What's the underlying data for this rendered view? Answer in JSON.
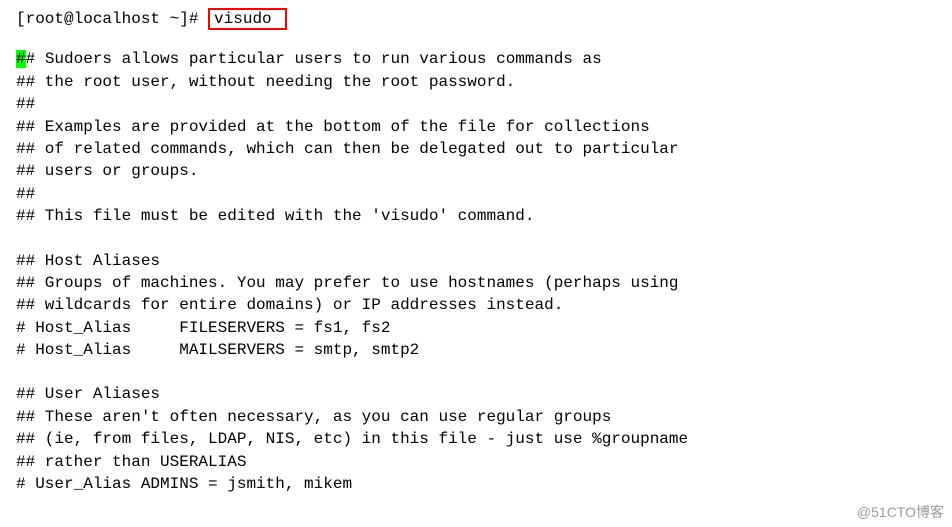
{
  "prompt": {
    "prefix": "[root@localhost ~]#",
    "command": "visudo"
  },
  "cursor_char": "#",
  "lines": [
    "# Sudoers allows particular users to run various commands as",
    "## the root user, without needing the root password.",
    "##",
    "## Examples are provided at the bottom of the file for collections",
    "## of related commands, which can then be delegated out to particular",
    "## users or groups.",
    "##",
    "## This file must be edited with the 'visudo' command.",
    "",
    "## Host Aliases",
    "## Groups of machines. You may prefer to use hostnames (perhaps using",
    "## wildcards for entire domains) or IP addresses instead.",
    "# Host_Alias     FILESERVERS = fs1, fs2",
    "# Host_Alias     MAILSERVERS = smtp, smtp2",
    "",
    "## User Aliases",
    "## These aren't often necessary, as you can use regular groups",
    "## (ie, from files, LDAP, NIS, etc) in this file - just use %groupname",
    "## rather than USERALIAS",
    "# User_Alias ADMINS = jsmith, mikem"
  ],
  "watermark": "@51CTO博客"
}
